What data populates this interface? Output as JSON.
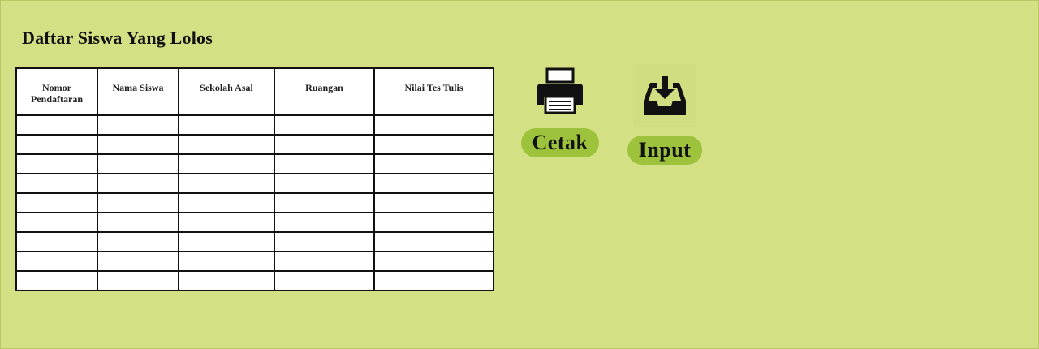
{
  "page": {
    "title": "Daftar Siswa Yang Lolos"
  },
  "table": {
    "headers": [
      "Nomor Pendaftaran",
      "Nama Siswa",
      "Sekolah Asal",
      "Ruangan",
      "Nilai Tes Tulis"
    ],
    "rows": [
      [
        "",
        "",
        "",
        "",
        ""
      ],
      [
        "",
        "",
        "",
        "",
        ""
      ],
      [
        "",
        "",
        "",
        "",
        ""
      ],
      [
        "",
        "",
        "",
        "",
        ""
      ],
      [
        "",
        "",
        "",
        "",
        ""
      ],
      [
        "",
        "",
        "",
        "",
        ""
      ],
      [
        "",
        "",
        "",
        "",
        ""
      ],
      [
        "",
        "",
        "",
        "",
        ""
      ],
      [
        "",
        "",
        "",
        "",
        ""
      ]
    ]
  },
  "actions": {
    "print": {
      "label": "Cetak",
      "icon": "printer-icon"
    },
    "input": {
      "label": "Input",
      "icon": "inbox-download-icon"
    }
  },
  "colors": {
    "background": "#d3e084",
    "button": "#9dc23b",
    "table_bg": "#ffffff",
    "border": "#111111"
  }
}
